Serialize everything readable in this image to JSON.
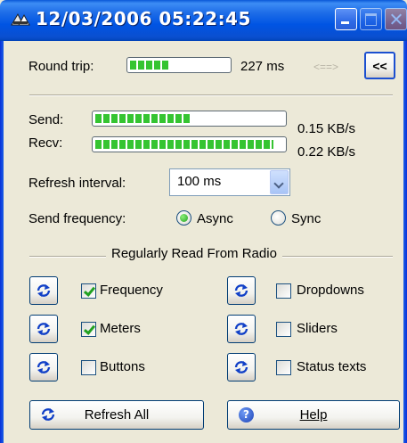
{
  "window": {
    "title": "12/03/2006 05:22:45"
  },
  "round_trip": {
    "label": "Round trip:",
    "value": "227 ms",
    "arrow_hint": "<==>",
    "collapse_button": "<<",
    "bar_fraction": 0.4
  },
  "send": {
    "label": "Send:",
    "rate": "0.15 KB/s",
    "bar_fraction": 0.5
  },
  "recv": {
    "label": "Recv:",
    "rate": "0.22 KB/s",
    "bar_fraction": 0.95
  },
  "refresh_interval": {
    "label": "Refresh interval:",
    "selected": "100 ms"
  },
  "send_frequency": {
    "label": "Send frequency:",
    "options": [
      "Async",
      "Sync"
    ],
    "selected": "Async"
  },
  "group": {
    "title": "Regularly Read From Radio",
    "items": [
      {
        "label": "Frequency",
        "checked": true
      },
      {
        "label": "Meters",
        "checked": true
      },
      {
        "label": "Buttons",
        "checked": false
      },
      {
        "label": "Dropdowns",
        "checked": false
      },
      {
        "label": "Sliders",
        "checked": false
      },
      {
        "label": "Status texts",
        "checked": false
      }
    ]
  },
  "footer": {
    "refresh_all": "Refresh All",
    "help": "Help"
  },
  "colors": {
    "titlebar": "#0054e3",
    "progress": "#35c431",
    "face": "#ece9d8"
  },
  "icons": {
    "app": "app-logo-icon",
    "refresh": "refresh-arrows-icon",
    "help": "help-icon"
  }
}
